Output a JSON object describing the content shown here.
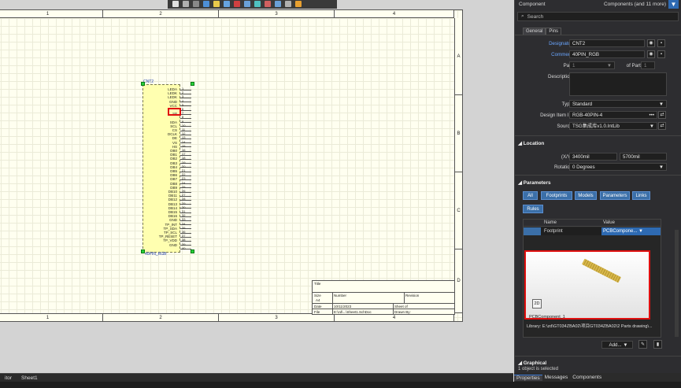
{
  "schematic": {
    "zones_columns": [
      "1",
      "2",
      "3",
      "4"
    ],
    "zones_rows": [
      "A",
      "B",
      "C",
      "D"
    ],
    "component": {
      "designator": "CNT2",
      "comment": "40PIN_RGB",
      "pins": [
        {
          "num": "1",
          "name": "LEDA"
        },
        {
          "num": "2",
          "name": "LEDK"
        },
        {
          "num": "3",
          "name": "LEDK"
        },
        {
          "num": "4",
          "name": "GND"
        },
        {
          "num": "5",
          "name": "VCC"
        },
        {
          "num": "6",
          "name": ""
        },
        {
          "num": "7",
          "name": "SP"
        },
        {
          "num": "8",
          "name": ""
        },
        {
          "num": "9",
          "name": "SDA"
        },
        {
          "num": "10",
          "name": "SCL"
        },
        {
          "num": "11",
          "name": "CS"
        },
        {
          "num": "12",
          "name": "DCLK"
        },
        {
          "num": "13",
          "name": "DE"
        },
        {
          "num": "14",
          "name": "VS"
        },
        {
          "num": "15",
          "name": "HS"
        },
        {
          "num": "16",
          "name": "DB0"
        },
        {
          "num": "17",
          "name": "DB1"
        },
        {
          "num": "18",
          "name": "DB2"
        },
        {
          "num": "19",
          "name": "DB3"
        },
        {
          "num": "20",
          "name": "DB4"
        },
        {
          "num": "21",
          "name": "DB5"
        },
        {
          "num": "22",
          "name": "DB6"
        },
        {
          "num": "23",
          "name": "DB7"
        },
        {
          "num": "24",
          "name": "DB8"
        },
        {
          "num": "25",
          "name": "DB9"
        },
        {
          "num": "26",
          "name": "DB10"
        },
        {
          "num": "27",
          "name": "DB11"
        },
        {
          "num": "28",
          "name": "DB12"
        },
        {
          "num": "29",
          "name": "DB13"
        },
        {
          "num": "30",
          "name": "DB14"
        },
        {
          "num": "31",
          "name": "DB15"
        },
        {
          "num": "32",
          "name": "DB16"
        },
        {
          "num": "33",
          "name": "GND"
        },
        {
          "num": "34",
          "name": "TP_INT"
        },
        {
          "num": "35",
          "name": "TP_SDA"
        },
        {
          "num": "36",
          "name": "TP_SCL"
        },
        {
          "num": "37",
          "name": "TP_RESET"
        },
        {
          "num": "38",
          "name": "TP_VDD"
        },
        {
          "num": "39",
          "name": "GND"
        },
        {
          "num": "40",
          "name": ""
        }
      ]
    },
    "titleblock": {
      "title": "Title",
      "size_label": "Size",
      "size_value": "A4",
      "number_label": "Number",
      "revision_label": "Revision",
      "date_label": "Date",
      "date_value": "10/11/2023",
      "file_label": "File",
      "file_value": "E:\\zd\\...\\Sheet1.SchDoc",
      "sheet_of": "Sheet of",
      "drawn_by": "Drawn By:"
    }
  },
  "bottom_tabs": [
    "itor",
    "Sheet1"
  ],
  "panel": {
    "title": "Component",
    "filter_text": "Components (and 11 more)",
    "search_placeholder": "Search",
    "tabs": [
      "General",
      "Pins"
    ],
    "designator_label": "Designator",
    "designator_value": "CNT2",
    "comment_label": "Comment",
    "comment_value": "40PIN_RGB",
    "part_label": "Part",
    "part_value": "1",
    "of_parts_label": "of Parts",
    "of_parts_value": "1",
    "description_label": "Description",
    "type_label": "Type",
    "type_value": "Standard",
    "design_item_label": "Design Item ID",
    "design_item_value": "RGB-40PIN-4",
    "source_label": "Source",
    "source_value": "TSG集成库v1.0.IntLib",
    "location_section": "Location",
    "xy_label": "(X/Y)",
    "x_value": "3400mil",
    "y_value": "5700mil",
    "rotation_label": "Rotation",
    "rotation_value": "0 Degrees",
    "parameters_section": "Parameters",
    "chips": [
      "All",
      "Footprints",
      "Models",
      "Parameters",
      "Links",
      "Rules"
    ],
    "col_name": "Name",
    "col_value": "Value",
    "row_name": "Footprint",
    "row_value": "PCBCompone... ▼",
    "preview_2d": "2D",
    "preview_name": "PCBComponent_1",
    "library_text": "Library: E:\\zd\\GT034ZBA02\\项目GT034ZBA02\\2 Parts drawing\\...",
    "add_button": "Add...",
    "graphical_section": "Graphical",
    "status_text": "1 object is selected"
  },
  "panel_tabs": [
    "Properties",
    "Messages",
    "Components"
  ]
}
